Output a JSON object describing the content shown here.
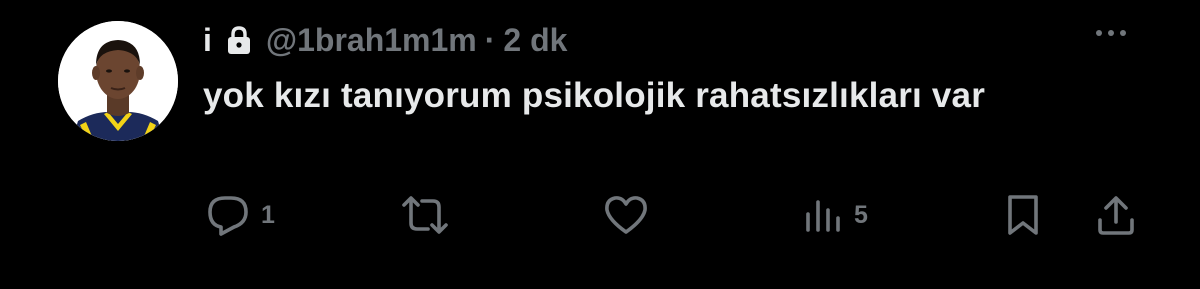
{
  "tweet": {
    "display_name": "i",
    "handle": "@1brah1m1m",
    "separator": "·",
    "time": "2 dk",
    "text": "yok kızı tanıyorum psikolojik rahatsızlıkları var"
  },
  "actions": {
    "reply_count": "1",
    "retweet_count": "",
    "like_count": "",
    "views_count": "5"
  },
  "icons": {
    "lock": "lock-icon",
    "more": "more-icon",
    "reply": "reply-icon",
    "retweet": "retweet-icon",
    "like": "heart-icon",
    "views": "views-icon",
    "bookmark": "bookmark-icon",
    "share": "share-icon"
  },
  "colors": {
    "background": "#000000",
    "text_primary": "#e7e9ea",
    "text_secondary": "#71767b"
  }
}
